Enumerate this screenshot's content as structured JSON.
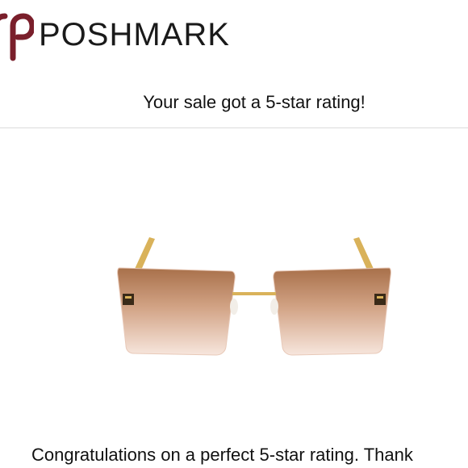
{
  "header": {
    "brand_name": "POSHMARK",
    "logo_icon": "poshmark-logo-icon",
    "brand_color": "#7a1f2b"
  },
  "main": {
    "headline": "Your sale got a 5-star rating!",
    "product_image": {
      "icon": "sunglasses-image",
      "lens_color_top": "#b07a55",
      "lens_color_bottom": "#f4ddd2",
      "frame_color": "#d9b25a"
    },
    "body_text": "Congratulations on a perfect 5-star rating. Thank"
  }
}
